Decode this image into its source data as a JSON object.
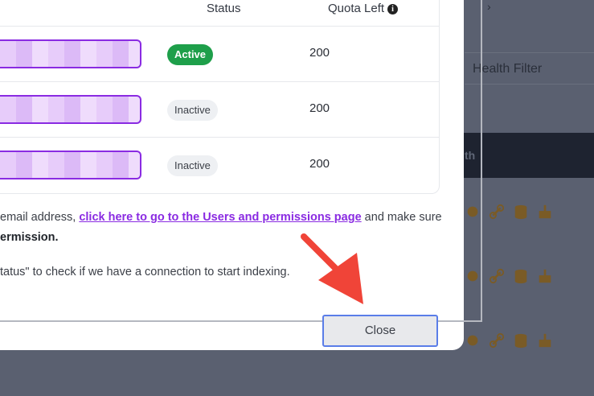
{
  "background": {
    "filter_label": "Health Filter",
    "header_partial": "th",
    "chevron": "›"
  },
  "table": {
    "headers": {
      "status": "Status",
      "quota": "Quota Left"
    },
    "rows": [
      {
        "status": "Active",
        "quota": "200"
      },
      {
        "status": "Inactive",
        "quota": "200"
      },
      {
        "status": "Inactive",
        "quota": "200"
      }
    ]
  },
  "message": {
    "line1_prefix": "email address, ",
    "line1_link": "click here to go to the Users and permissions page",
    "line1_suffix": " and make sure",
    "line2": "ermission.",
    "line3": "tatus\" to check if we have a connection to start indexing."
  },
  "actions": {
    "close_label": "Close"
  },
  "colors": {
    "accent": "#8a2be2",
    "active_badge": "#1e9f4a",
    "annotation_arrow": "#f04438"
  }
}
